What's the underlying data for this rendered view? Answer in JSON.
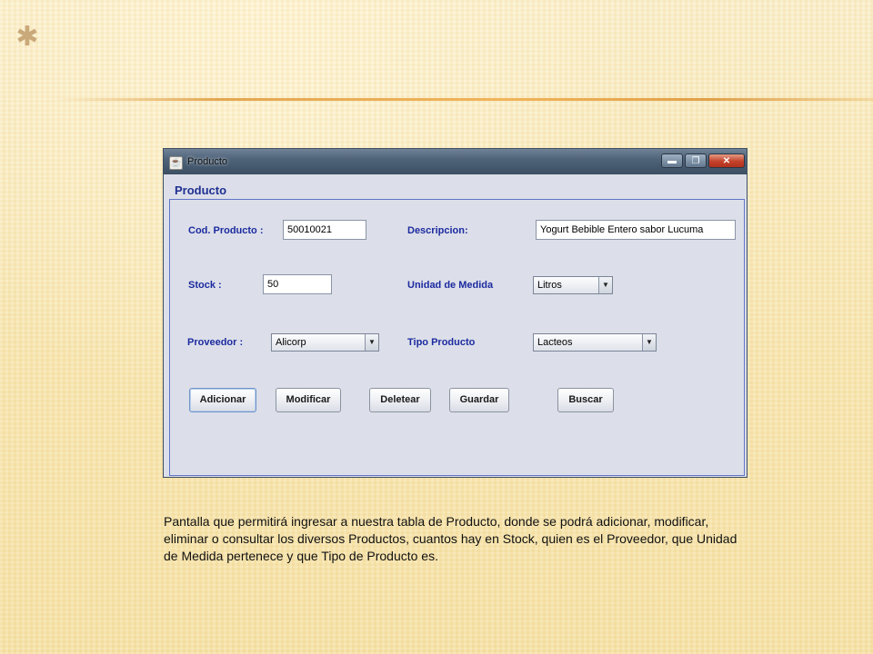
{
  "window": {
    "title": "Producto",
    "controls": {
      "minimize": "▬",
      "maximize": "❐",
      "close": "✕"
    }
  },
  "panel": {
    "title": "Producto"
  },
  "form": {
    "cod_producto": {
      "label": "Cod. Producto :",
      "value": "50010021"
    },
    "descripcion": {
      "label": "Descripcion:",
      "value": "Yogurt Bebible Entero sabor Lucuma"
    },
    "stock": {
      "label": "Stock :",
      "value": "50"
    },
    "unidad_medida": {
      "label": "Unidad de Medida",
      "selected": "Litros"
    },
    "proveedor": {
      "label": "Proveedor :",
      "selected": "Alicorp"
    },
    "tipo_producto": {
      "label": "Tipo Producto",
      "selected": "Lacteos"
    }
  },
  "buttons": {
    "adicionar": "Adicionar",
    "modificar": "Modificar",
    "deletear": "Deletear",
    "guardar": "Guardar",
    "buscar": "Buscar"
  },
  "caption": "Pantalla que permitirá ingresar a nuestra tabla de  Producto, donde se podrá adicionar, modificar, eliminar o consultar los diversos Productos, cuantos hay en Stock, quien es el Proveedor, que Unidad de Medida pertenece  y que Tipo de Producto es.",
  "icons": {
    "star": "✱",
    "app": "☕",
    "dropdown": "▼"
  },
  "colors": {
    "label_blue": "#1c2aa0",
    "title_blue": "#1f2f92",
    "accent_line": "#e3a752"
  }
}
